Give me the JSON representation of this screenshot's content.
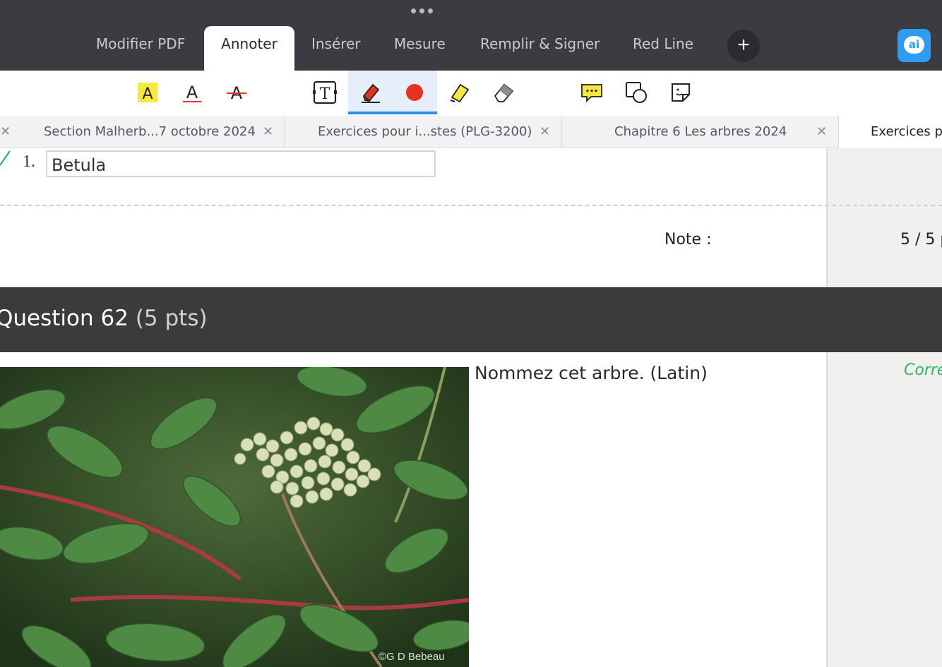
{
  "menu": {
    "tabs": [
      {
        "label": "Modifier PDF"
      },
      {
        "label": "Annoter"
      },
      {
        "label": "Insérer"
      },
      {
        "label": "Mesure"
      },
      {
        "label": "Remplir & Signer"
      },
      {
        "label": "Red Line"
      }
    ],
    "active_tab": "Annoter",
    "add_label": "+",
    "ai_label": "ai"
  },
  "toolbar": {
    "tools": [
      "highlight-text-icon",
      "underline-text-icon",
      "strikethrough-text-icon",
      "text-box-icon",
      "pen-icon",
      "color-dot-icon",
      "highlighter-icon",
      "eraser-icon",
      "comment-icon",
      "shapes-icon",
      "sticker-icon"
    ],
    "active_color": "#e8321f",
    "highlight_color": "#f6e93c",
    "accent_color": "#2f8cf0"
  },
  "doc_tabs": {
    "items": [
      {
        "label": "Section Malherb...7 octobre 2024"
      },
      {
        "label": "Exercices pour i...stes (PLG-3200)"
      },
      {
        "label": "Chapitre 6 Les arbres  2024"
      },
      {
        "label": "Exercices p"
      }
    ],
    "close_glyph": "✕"
  },
  "answer": {
    "number": "1.",
    "value": "Betula"
  },
  "grade": {
    "label": "Note :",
    "value": "5 / 5 p"
  },
  "question": {
    "title": "Question 62",
    "points": "(5 pts)",
    "prompt": "Nommez cet arbre. (Latin)",
    "correct_label": "Corre",
    "photo_credit": "©G D Bebeau"
  }
}
